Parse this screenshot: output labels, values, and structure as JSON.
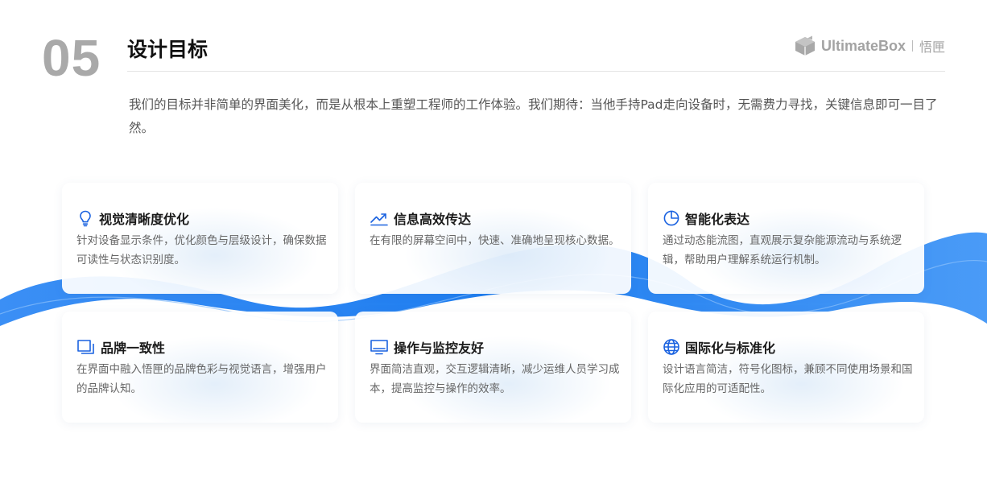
{
  "header": {
    "section_number": "05",
    "title": "设计目标",
    "brand_name": "UltimateBox",
    "brand_cn": "悟匣"
  },
  "intro": "我们的目标并非简单的界面美化，而是从根本上重塑工程师的工作体验。我们期待：当他手持Pad走向设备时，无需费力寻找，关键信息即可一目了然。",
  "colors": {
    "accent": "#1a62e0",
    "wave": "#2a86f3"
  },
  "cards": [
    {
      "icon": "lightbulb-icon",
      "title": "视觉清晰度优化",
      "desc": "针对设备显示条件，优化颜色与层级设计，确保数据可读性与状态识别度。"
    },
    {
      "icon": "trend-up-icon",
      "title": "信息高效传达",
      "desc": "在有限的屏幕空间中，快速、准确地呈现核心数据。"
    },
    {
      "icon": "pie-chart-icon",
      "title": "智能化表达",
      "desc": "通过动态能流图，直观展示复杂能源流动与系统逻辑，帮助用户理解系统运行机制。"
    },
    {
      "icon": "window-stack-icon",
      "title": "品牌一致性",
      "desc": "在界面中融入悟匣的品牌色彩与视觉语言，增强用户的品牌认知。"
    },
    {
      "icon": "monitor-icon",
      "title": "操作与监控友好",
      "desc": "界面简洁直观，交互逻辑清晰，减少运维人员学习成本，提高监控与操作的效率。"
    },
    {
      "icon": "globe-icon",
      "title": "国际化与标准化",
      "desc": "设计语言简洁，符号化图标，兼顾不同使用场景和国际化应用的可适配性。"
    }
  ]
}
